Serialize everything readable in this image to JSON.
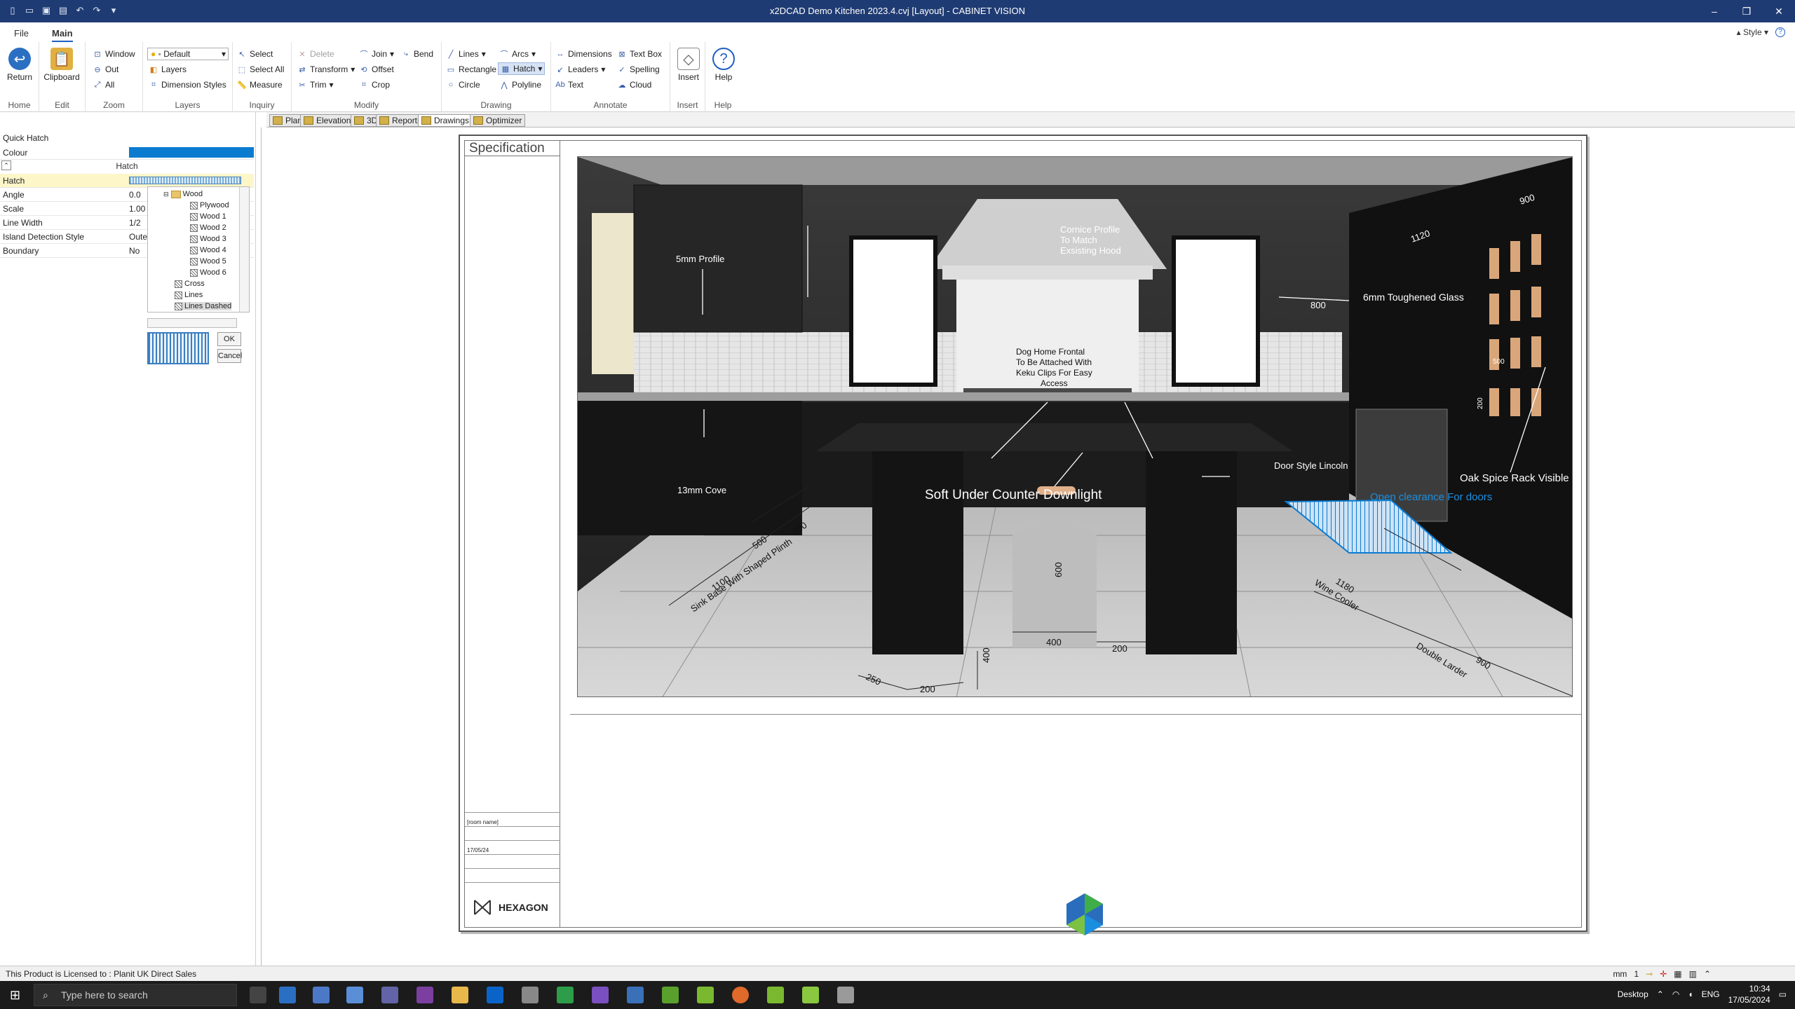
{
  "window": {
    "title": "x2DCAD Demo Kitchen 2023.4.cvj [Layout] - CABINET VISION",
    "controls": [
      "–",
      "❐",
      "✕"
    ]
  },
  "menu": {
    "tabs": [
      "File",
      "Main"
    ],
    "style_label": "Style"
  },
  "ribbon": {
    "home": {
      "return_label": "Return",
      "group": "Home"
    },
    "edit": {
      "clipboard_label": "Clipboard",
      "group": "Edit"
    },
    "zoom": {
      "window": "Window",
      "out": "Out",
      "all": "All",
      "group": "Zoom"
    },
    "layers": {
      "selected": "Default",
      "layers": "Layers",
      "dimension_styles": "Dimension Styles",
      "group": "Layers"
    },
    "inquiry": {
      "select": "Select",
      "select_all": "Select All",
      "measure": "Measure",
      "group": "Inquiry"
    },
    "modify": {
      "delete": "Delete",
      "transform": "Transform",
      "trim": "Trim",
      "join": "Join",
      "offset": "Offset",
      "crop": "Crop",
      "bend": "Bend",
      "group": "Modify"
    },
    "drawing": {
      "lines": "Lines",
      "rectangle": "Rectangle",
      "circle": "Circle",
      "arcs": "Arcs",
      "hatch": "Hatch",
      "polyline": "Polyline",
      "group": "Drawing"
    },
    "annotate": {
      "dimensions": "Dimensions",
      "leaders": "Leaders",
      "text": "Text",
      "text_box": "Text Box",
      "spelling": "Spelling",
      "cloud": "Cloud",
      "group": "Annotate"
    },
    "insert": {
      "insert": "Insert",
      "group": "Insert"
    },
    "help": {
      "help": "Help",
      "group": "Help"
    }
  },
  "quick_hatch": {
    "title": "Quick Hatch",
    "colour_label": "Colour",
    "colour": "#0b7bd0",
    "section": "Hatch",
    "properties": [
      {
        "name": "Hatch",
        "value": ""
      },
      {
        "name": "Angle",
        "value": "0.0"
      },
      {
        "name": "Scale",
        "value": "1.00"
      },
      {
        "name": "Line Width",
        "value": "1/2"
      },
      {
        "name": "Island Detection Style",
        "value": "Oute"
      },
      {
        "name": "Boundary",
        "value": "No"
      }
    ],
    "tree": {
      "folder": "Wood",
      "items": [
        "Plywood",
        "Wood 1",
        "Wood 2",
        "Wood 3",
        "Wood 4",
        "Wood 5",
        "Wood 6"
      ],
      "others": [
        "Cross",
        "Lines",
        "Lines Dashed"
      ],
      "selected": "Lines Dashed"
    },
    "ok_label": "OK",
    "cancel_label": "Cancel"
  },
  "doc_tabs": [
    "Plan",
    "Elevation",
    "3D",
    "Reports",
    "Drawings",
    "Optimizer"
  ],
  "active_doc_tab": "Drawings",
  "sheet": {
    "spec_title": "Specification",
    "title_block": [
      {
        "value": "[room name]"
      },
      {
        "value": ""
      },
      {
        "value": "17/05/24"
      },
      {
        "value": ""
      },
      {
        "value": ""
      },
      {
        "value": ""
      }
    ],
    "logo_text": "HEXAGON"
  },
  "scene": {
    "labels": {
      "profile": "5mm Profile",
      "cornice": [
        "Cornice Profile",
        "To Match",
        "Exsisting Hood"
      ],
      "glass": "6mm Toughened Glass",
      "dog": [
        "Dog Home Frontal",
        "To Be Attached With",
        "Keku Clips For Easy",
        "Access"
      ],
      "cove": "13mm Cove",
      "downlight": "Soft Under Counter Downlight",
      "door_style": "Door Style Lincoln",
      "spice": "Oak Spice Rack Visible",
      "clearance": "Open clearance For doors",
      "sink": "Sink Base With Shaped Plinth",
      "wine": "Wine Cooler",
      "larder": "Double Larder"
    },
    "dims": [
      "900",
      "1120",
      "800",
      "500",
      "700",
      "1100",
      "600",
      "400",
      "200",
      "250",
      "200",
      "400",
      "1180",
      "900",
      "500",
      "200"
    ]
  },
  "status": {
    "license": "This Product is Licensed to : Planit UK Direct Sales",
    "units": "mm",
    "scale": "1"
  },
  "taskbar": {
    "search_placeholder": "Type here to search",
    "desktop": "Desktop",
    "lang": "ENG",
    "time": "10:34",
    "date": "17/05/2024"
  }
}
